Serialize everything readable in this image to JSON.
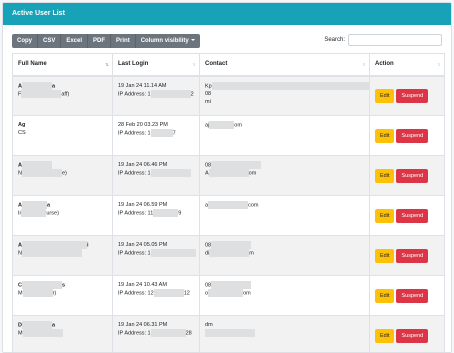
{
  "header": {
    "title": "Active User List"
  },
  "toolbar": {
    "buttons": [
      "Copy",
      "CSV",
      "Excel",
      "PDF",
      "Print",
      "Column visibility"
    ]
  },
  "search": {
    "label": "Search:",
    "value": ""
  },
  "table": {
    "columns": [
      "Full Name",
      "Last Login",
      "Contact",
      "Action"
    ],
    "actions": {
      "edit": "Edit",
      "suspend": "Suspend"
    },
    "rows": [
      {
        "name": "A",
        "name_end": "a",
        "role": "F",
        "role_end": "aff)",
        "login": "19 Jan 24 11.14 AM",
        "ip": "IP Address: 1",
        "ip_end": "2",
        "contact1": "Kp",
        "contact1_end": "r",
        "contact2": "08",
        "contact3": "mi"
      },
      {
        "name": "Ag",
        "name_end": "",
        "role": "CS",
        "role_end": "",
        "login": "28 Feb 20 03.23 PM",
        "ip": "IP Address: 1",
        "ip_end": "7",
        "contact1": "",
        "contact1_end": "",
        "contact2": "aj",
        "contact2_end": "om",
        "contact3": ""
      },
      {
        "name": "A",
        "name_end": "",
        "role": "N",
        "role_end": "e)",
        "login": "19 Jan 24 06.46 PM",
        "ip": "IP Address: 1",
        "ip_end": "",
        "contact1": "",
        "contact1_end": "",
        "contact2": "08",
        "contact3": "A",
        "contact3_end": "om"
      },
      {
        "name": "A",
        "name_end": "a",
        "role": "Ir",
        "role_end": "urse)",
        "login": "19 Jan 24 06.59 PM",
        "ip": "IP Address: 11",
        "ip_end": "9",
        "contact1": "",
        "contact1_end": "",
        "contact2": "a",
        "contact2_end": "com",
        "contact3": ""
      },
      {
        "name": "A",
        "name_end": "i",
        "role": "N",
        "role_end": "",
        "login": "19 Jan 24 05.05 PM",
        "ip": "IP Address: 1",
        "ip_end": "",
        "contact1": "",
        "contact1_end": "",
        "contact2": "08",
        "contact3": "di",
        "contact3_end": "m"
      },
      {
        "name": "C",
        "name_end": "s",
        "role": "M",
        "role_end": "r)",
        "login": "19 Jan 24 10.43 AM",
        "ip": "IP Address: 12",
        "ip_end": "12",
        "contact1": "",
        "contact1_end": "",
        "contact2": "08",
        "contact3": "o",
        "contact3_end": "om"
      },
      {
        "name": "D",
        "name_end": "a",
        "role": "M",
        "role_end": "",
        "login": "19 Jan 24 06.31 PM",
        "ip": "IP Address: 1",
        "ip_end": "28",
        "contact1": "",
        "contact1_end": "",
        "contact2": "d",
        "contact2_end": "m",
        "contact3": ""
      }
    ]
  }
}
